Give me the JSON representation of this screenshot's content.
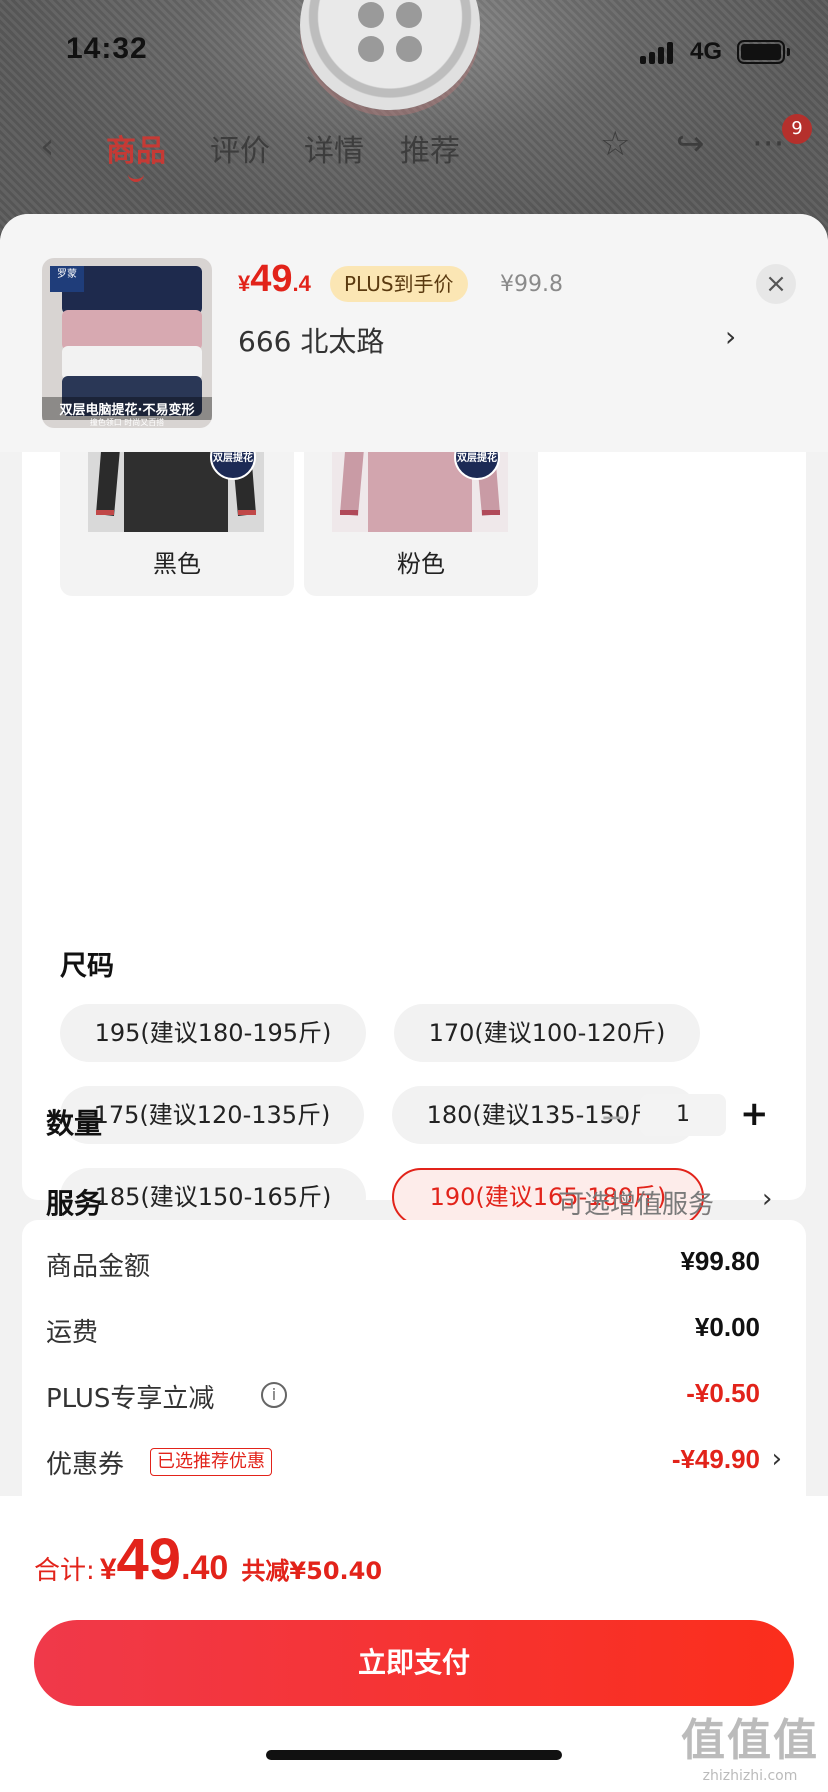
{
  "status_bar": {
    "time": "14:32",
    "network": "4G"
  },
  "top_nav": {
    "tabs": [
      "商品",
      "评价",
      "详情",
      "推荐"
    ],
    "active_tab": "商品",
    "badge": "9"
  },
  "sheet": {
    "thumb": {
      "logo": "罗蒙",
      "caption": "双层电脑提花·不易变形",
      "sub": "撞色领口 时尚又百搭"
    },
    "price": {
      "currency": "¥",
      "integer": "49",
      "decimal": ".4"
    },
    "plus_tag": "PLUS到手价",
    "original_price": "¥99.8",
    "selected_spec": "666  北太路",
    "colors": [
      {
        "label": "黑色",
        "stamp": "双层提花"
      },
      {
        "label": "粉色",
        "stamp": "双层提花"
      }
    ],
    "size_title": "尺码",
    "sizes": [
      "195(建议180-195斤)",
      "170(建议100-120斤)",
      "175(建议120-135斤)",
      "180(建议135-150斤)",
      "185(建议150-165斤)",
      "190(建议165-180斤)"
    ],
    "selected_size": "190(建议165-180斤)",
    "quantity": {
      "label": "数量",
      "value": "1",
      "minus": "−",
      "plus": "+"
    },
    "service": {
      "label": "服务",
      "value": "可选增值服务"
    }
  },
  "fees": [
    {
      "key": "商品金额",
      "value": "¥99.80"
    },
    {
      "key": "运费",
      "value": "¥0.00"
    },
    {
      "key": "PLUS专享立减",
      "value": "-¥0.50"
    },
    {
      "key": "优惠券",
      "tag": "已选推荐优惠",
      "value": "-¥49.90"
    }
  ],
  "footer": {
    "total_label": "合计:",
    "total_currency": "¥",
    "total_integer": "49",
    "total_decimal": ".40",
    "saved": "共减¥50.40",
    "pay_button": "立即支付"
  },
  "watermark": {
    "main": "值值值",
    "sub": "zhizhizhi.com"
  },
  "colors": {
    "accent": "#e2231a",
    "plus_tag_bg": "#fbe6b4"
  }
}
